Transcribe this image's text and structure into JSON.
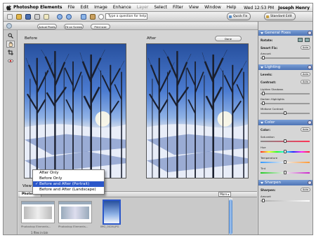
{
  "menubar": {
    "app": "Photoshop Elements",
    "items": [
      "File",
      "Edit",
      "Image",
      "Enhance",
      "Layer",
      "Select",
      "Filter",
      "View",
      "Window",
      "Help"
    ],
    "clock": "Wed 12:53 PM",
    "user": "Joseph Henry"
  },
  "toolbar": {
    "help_placeholder": "Type a question for help",
    "quick_fix": "Quick Fix",
    "standard_edit": "Standard Edit"
  },
  "options_bar": {
    "actual_pixels": "Actual Pixels",
    "fit_on_screen": "Fit on Screen",
    "print_size": "Print size"
  },
  "workspace": {
    "before_label": "Before",
    "after_label": "After",
    "done_button": "Done",
    "view_label": "View",
    "view_menu": [
      {
        "label": "After Only",
        "checked": false
      },
      {
        "label": "Before Only",
        "checked": false
      },
      {
        "label": "Before and After (Portrait)",
        "checked": true
      },
      {
        "label": "Before and After (Landscape)",
        "checked": false
      }
    ]
  },
  "photo_bin": {
    "tab_label": "Photo bin",
    "more_button": "More ▸",
    "thumbnails": [
      "Photoshop Elements...",
      "Photoshop Elements...",
      "IMG_0026.JPG"
    ],
    "footer": "1 files in bin"
  },
  "palette": {
    "general_fixes": {
      "title": "General Fixes",
      "rotate": "Rotate:",
      "smart_fix": "Smart Fix:",
      "smart_fix_auto": "Auto",
      "amount": "Amount"
    },
    "lighting": {
      "title": "Lighting",
      "levels": "Levels:",
      "levels_auto": "Auto",
      "contrast": "Contrast:",
      "contrast_auto": "Auto",
      "lighten_shadows": "Lighten Shadows",
      "darken_highlights": "Darken Highlights",
      "midtone_contrast": "Midtone Contrast"
    },
    "color": {
      "title": "Color",
      "color_label": "Color:",
      "color_auto": "Auto",
      "saturation": "Saturation",
      "hue": "Hue",
      "temperature": "Temperature",
      "tint": "Tint"
    },
    "sharpen": {
      "title": "Sharpen",
      "sharpen_label": "Sharpen:",
      "sharpen_auto": "Auto",
      "amount": "Amount"
    }
  },
  "colors": {
    "accent": "#2b57c9",
    "palette_header": "#5b82c2",
    "sky_top": "#27509e",
    "snow": "#eef2fa"
  },
  "icons": [
    "apple-icon",
    "new-file-icon",
    "open-icon",
    "save-icon",
    "print-icon",
    "email-icon",
    "undo-icon",
    "redo-icon",
    "zoom-tool-icon",
    "hand-tool-icon",
    "crop-tool-icon",
    "red-eye-tool-icon",
    "rotate-left-icon",
    "rotate-right-icon"
  ]
}
